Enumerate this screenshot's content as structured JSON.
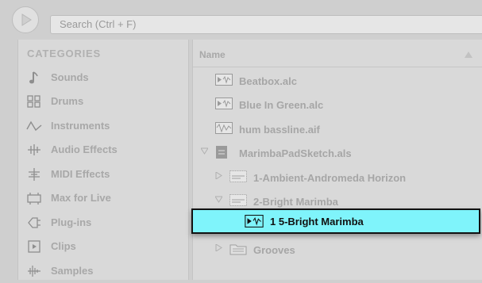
{
  "search": {
    "placeholder": "Search (Ctrl + F)"
  },
  "categories": {
    "header": "CATEGORIES",
    "items": [
      {
        "label": "Sounds",
        "icon": "note-icon"
      },
      {
        "label": "Drums",
        "icon": "drum-grid-icon"
      },
      {
        "label": "Instruments",
        "icon": "waveform-icon"
      },
      {
        "label": "Audio Effects",
        "icon": "audio-effect-icon"
      },
      {
        "label": "MIDI Effects",
        "icon": "midi-effect-icon"
      },
      {
        "label": "Max for Live",
        "icon": "max-for-live-icon"
      },
      {
        "label": "Plug-ins",
        "icon": "plugin-icon"
      },
      {
        "label": "Clips",
        "icon": "clip-icon"
      },
      {
        "label": "Samples",
        "icon": "sample-wave-icon"
      }
    ]
  },
  "browser": {
    "column_header": "Name",
    "rows": [
      {
        "label": "Beatbox.alc",
        "icon": "audio-clip-icon"
      },
      {
        "label": "Blue In Green.alc",
        "icon": "audio-clip-icon"
      },
      {
        "label": "hum bassline.aif",
        "icon": "audio-sample-icon"
      },
      {
        "label": "MarimbaPadSketch.als",
        "icon": "live-set-icon"
      },
      {
        "label": "1-Ambient-Andromeda Horizon",
        "icon": "track-icon"
      },
      {
        "label": "2-Bright Marimba",
        "icon": "track-icon"
      },
      {
        "label": "1 5-Bright Marimba",
        "icon": "audio-clip-icon",
        "selected": true
      },
      {
        "label": "Grooves",
        "icon": "folder-icon"
      }
    ]
  },
  "colors": {
    "selection": "#7ff4fb",
    "panel": "#d9d9d9",
    "text_dim": "#a8a8a8"
  }
}
